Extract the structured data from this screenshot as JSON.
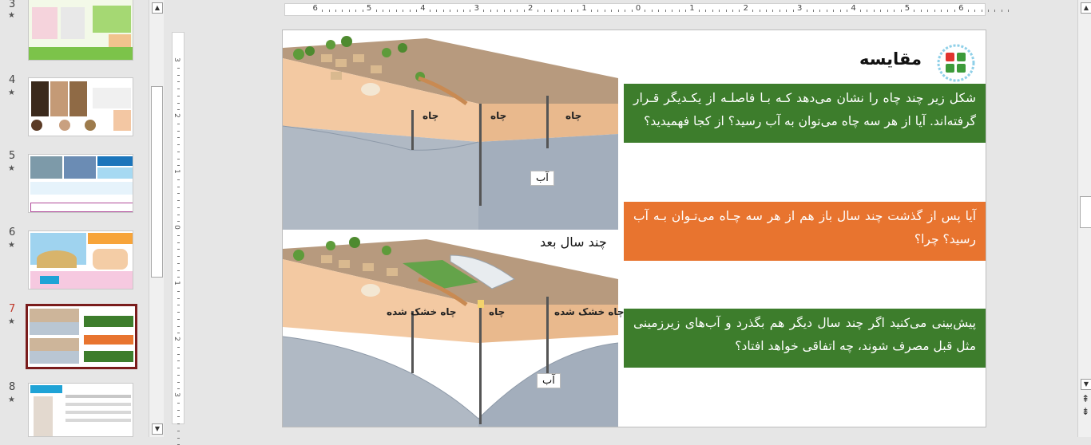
{
  "thumbnails": [
    {
      "number": "3",
      "star": "★"
    },
    {
      "number": "4",
      "star": "★"
    },
    {
      "number": "5",
      "star": "★"
    },
    {
      "number": "6",
      "star": "★"
    },
    {
      "number": "7",
      "star": "★"
    },
    {
      "number": "8",
      "star": "★"
    }
  ],
  "hruler": {
    "labels": [
      "6",
      "5",
      "4",
      "3",
      "2",
      "1",
      "0",
      "1",
      "2",
      "3",
      "4",
      "5",
      "6"
    ]
  },
  "vruler": {
    "labels": [
      "3",
      "2",
      "1",
      "0",
      "1",
      "2",
      "3"
    ]
  },
  "scroll": {
    "up": "▲",
    "down": "▼",
    "prev_slide": "⇞",
    "next_slide": "⇟"
  },
  "slide": {
    "title": "مقایسه",
    "box1": "شکل زیر چند چاه را نشان می‌دهد کـه بـا فاصلـه از یکـدیگر قـرار گرفته‌اند. آیا از هر سه چاه می‌توان به آب رسید؟ از کجا فهمیدید؟",
    "box2": "آیا پس از گذشت چند سال باز هم از هر سه چـاه می‌تـوان بـه آب رسید؟ چرا؟",
    "box3": "پیش‌بینی می‌کنید اگر چند سال دیگر هم بگذرد و آب‌های زیرزمینی مثل قبل مصرف شوند، چه اتفاقی خواهد افتاد؟",
    "years_later": "چند سال بعد",
    "diagram_top": {
      "well": "چاه",
      "water": "آب"
    },
    "diagram_bottom": {
      "dry_well": "چاه خشک شده",
      "well": "چاه",
      "water": "آب"
    }
  },
  "colors": {
    "green": "#3d7d2c",
    "orange": "#e8742f",
    "selected_border": "#7a1c1c"
  }
}
